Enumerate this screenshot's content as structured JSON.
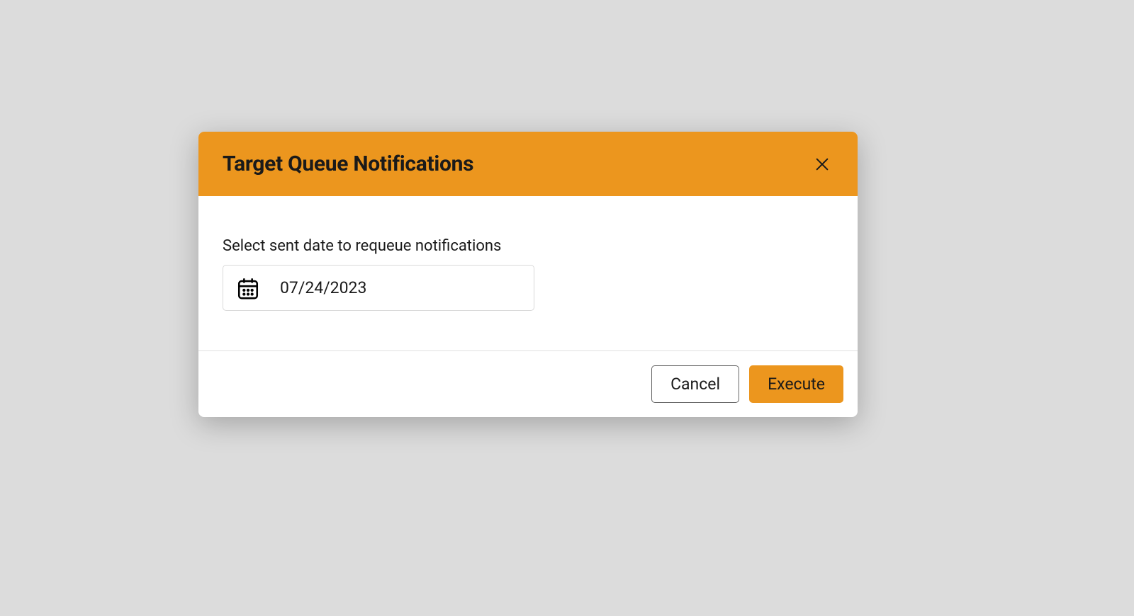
{
  "modal": {
    "title": "Target Queue Notifications",
    "label": "Select sent date to requeue notifications",
    "dateValue": "07/24/2023",
    "buttons": {
      "cancel": "Cancel",
      "execute": "Execute"
    }
  },
  "colors": {
    "accent": "#ec961e"
  }
}
